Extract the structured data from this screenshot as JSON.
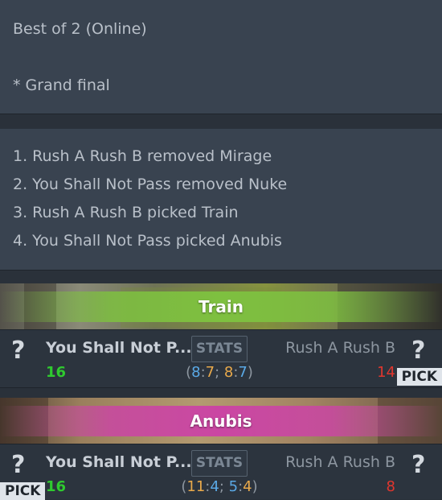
{
  "info": {
    "format": "Best of 2 (Online)",
    "stage": "* Grand final"
  },
  "veto": [
    "1. Rush A Rush B removed Mirage",
    "2. You Shall Not Pass removed Nuke",
    "3. Rush A Rush B picked Train",
    "4. You Shall Not Pass picked Anubis"
  ],
  "maps": [
    {
      "name": "Train",
      "accent": "#7ec040",
      "team_left": "You Shall Not P...",
      "team_right": "Rush A Rush B",
      "score_left": "16",
      "score_right": "14",
      "stats_label": "STATS",
      "split": {
        "open": "(",
        "a": "8",
        "b": "7",
        "sep": "; ",
        "c": "8",
        "d": "7",
        "close": ")"
      },
      "pick_label": "PICK",
      "unknown_icon": "?"
    },
    {
      "name": "Anubis",
      "accent": "#ca46a3",
      "team_left": "You Shall Not P...",
      "team_right": "Rush A Rush B",
      "score_left": "16",
      "score_right": "8",
      "stats_label": "STATS",
      "split": {
        "open": "(",
        "a": "11",
        "b": "4",
        "sep": "; ",
        "c": "5",
        "d": "4",
        "close": ")"
      },
      "pick_label": "PICK",
      "unknown_icon": "?"
    }
  ],
  "colors": {
    "win": "#2fca2f",
    "loss": "#e0362e",
    "ct": "#5aa9e6",
    "t": "#e8a94b"
  }
}
